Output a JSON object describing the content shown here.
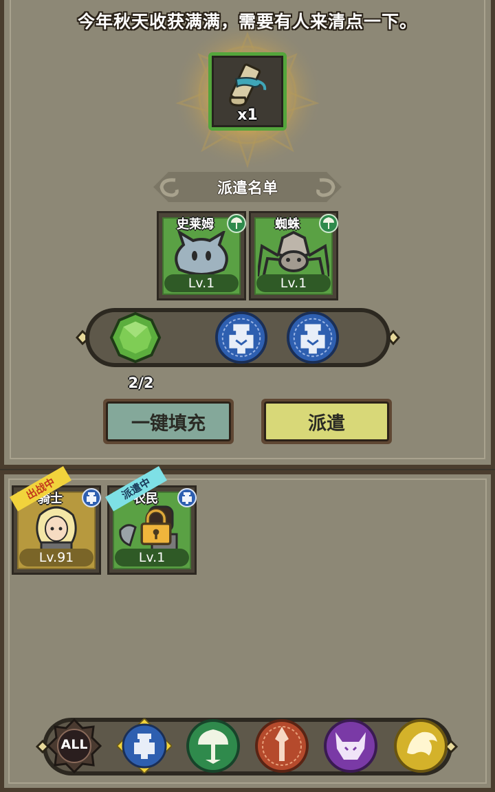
{
  "quest": {
    "description": "今年秋天收获满满，需要有人来清点一下。",
    "reward": {
      "icon": "scroll-icon",
      "count": "x1"
    }
  },
  "dispatch": {
    "title": "派遣名单",
    "required": [
      {
        "name": "史莱姆",
        "level": "Lv.1",
        "faction": "nature",
        "icon": "slime-icon"
      },
      {
        "name": "蜘蛛",
        "level": "Lv.1",
        "faction": "nature",
        "icon": "spider-icon"
      }
    ],
    "conditions": {
      "count": "2/2",
      "items": [
        "green-gem-icon",
        "human-faction-icon",
        "human-faction-icon"
      ]
    },
    "buttons": {
      "autofill": "一键填充",
      "dispatch": "派遣"
    }
  },
  "roster": [
    {
      "name": "骑士",
      "level": "Lv.91",
      "status": "出战中",
      "faction": "human",
      "bg": "#b7993e",
      "status_color": "#f1d33c"
    },
    {
      "name": "农民",
      "level": "Lv.1",
      "status": "派遣中",
      "faction": "human",
      "bg": "#5aa144",
      "status_color": "#7ee0e6",
      "locked": true
    }
  ],
  "filters": [
    {
      "label": "ALL",
      "icon": "all-filter-icon"
    },
    {
      "label": "",
      "icon": "human-faction-icon",
      "selected": true
    },
    {
      "label": "",
      "icon": "nature-faction-icon"
    },
    {
      "label": "",
      "icon": "orc-faction-icon"
    },
    {
      "label": "",
      "icon": "demon-faction-icon"
    },
    {
      "label": "",
      "icon": "beast-faction-icon"
    }
  ],
  "colors": {
    "panel": "#8d8876",
    "frame": "#4a3d2e",
    "nature": "#2f8a4c",
    "human": "#2e5fb0",
    "orc": "#b54a2c",
    "demon": "#7a3aa6",
    "beast": "#d4b22a",
    "selected_border": "#f2d33a"
  }
}
